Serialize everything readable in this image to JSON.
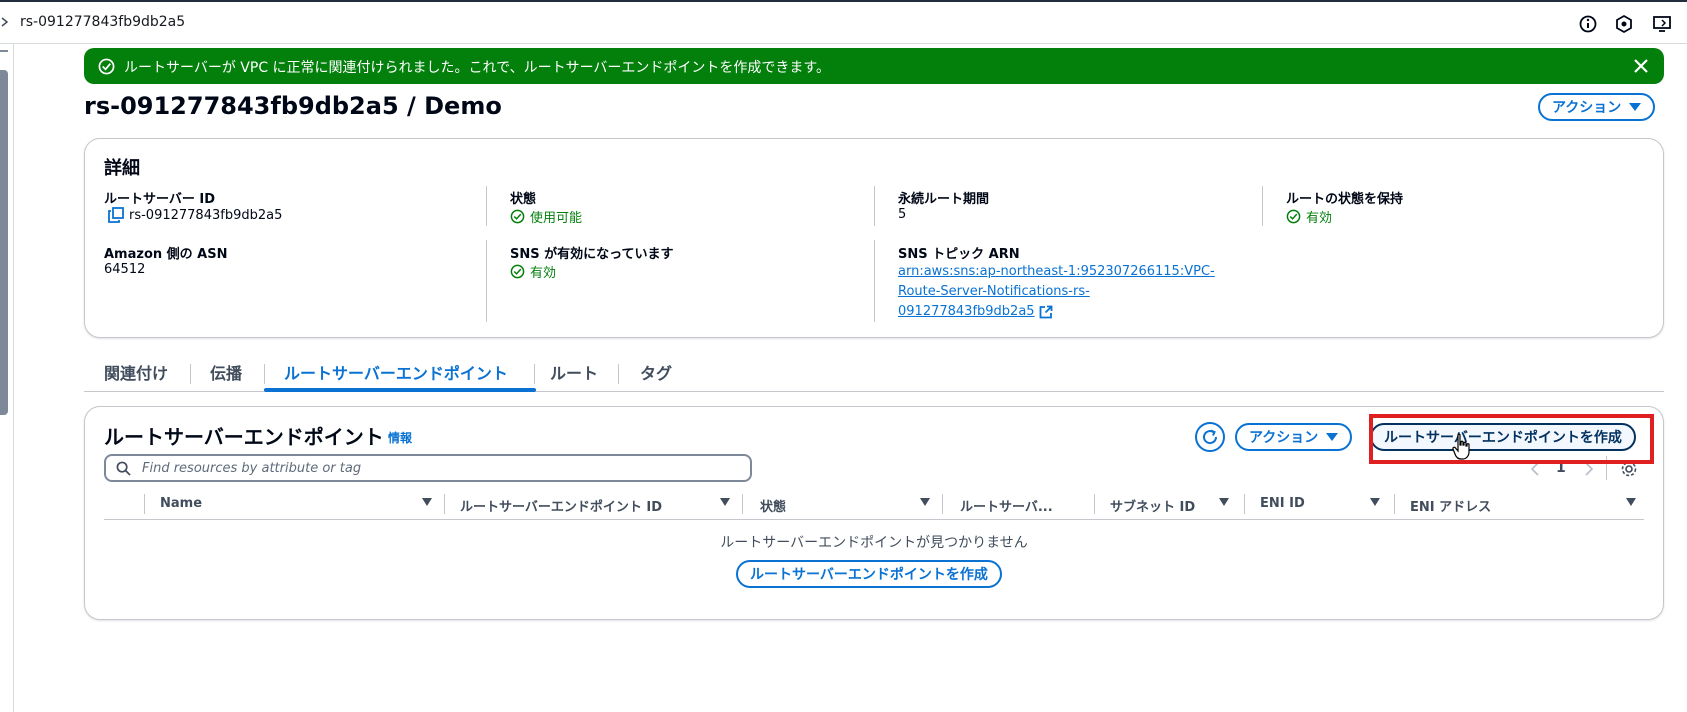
{
  "topbar": {
    "breadcrumb": "rs-091277843fb9db2a5",
    "icons": [
      "info-icon",
      "settings-shield-icon",
      "display-icon"
    ]
  },
  "flash": {
    "type": "success",
    "message": "ルートサーバーが VPC に正常に関連付けられました。これで、ルートサーバーエンドポイントを作成できます。"
  },
  "header": {
    "title": "rs-091277843fb9db2a5 / Demo",
    "actions_label": "アクション"
  },
  "details": {
    "title": "詳細",
    "route_server_id_label": "ルートサーバー ID",
    "route_server_id": "rs-091277843fb9db2a5",
    "state_label": "状態",
    "state_value": "使用可能",
    "persist_period_label": "永続ルート期間",
    "persist_period_value": "5",
    "persist_state_label": "ルートの状態を保持",
    "persist_state_value": "有効",
    "asn_label": "Amazon 側の ASN",
    "asn_value": "64512",
    "sns_label": "SNS が有効になっています",
    "sns_value": "有効",
    "sns_arn_label": "SNS トピック ARN",
    "sns_arn_lines": [
      "arn:aws:sns:ap-northeast-1:952307266115:VPC-",
      "Route-Server-Notifications-rs-",
      "091277843fb9db2a5"
    ]
  },
  "tabs": [
    {
      "label": "関連付け",
      "active": false
    },
    {
      "label": "伝播",
      "active": false
    },
    {
      "label": "ルートサーバーエンドポイント",
      "active": true
    },
    {
      "label": "ルート",
      "active": false
    },
    {
      "label": "タグ",
      "active": false
    }
  ],
  "endpoints": {
    "title": "ルートサーバーエンドポイント",
    "info_label": "情報",
    "actions_label": "アクション",
    "create_label": "ルートサーバーエンドポイントを作成",
    "search_placeholder": "Find resources by attribute or tag",
    "page_number": "1",
    "columns": [
      "Name",
      "ルートサーバーエンドポイント ID",
      "状態",
      "ルートサーバ...",
      "サブネット ID",
      "ENI ID",
      "ENI アドレス"
    ],
    "empty_message": "ルートサーバーエンドポイントが見つかりません",
    "empty_create_label": "ルートサーバーエンドポイントを作成"
  },
  "colors": {
    "primary": "#0972d3",
    "success": "#037f0c",
    "highlight": "#e02020"
  }
}
